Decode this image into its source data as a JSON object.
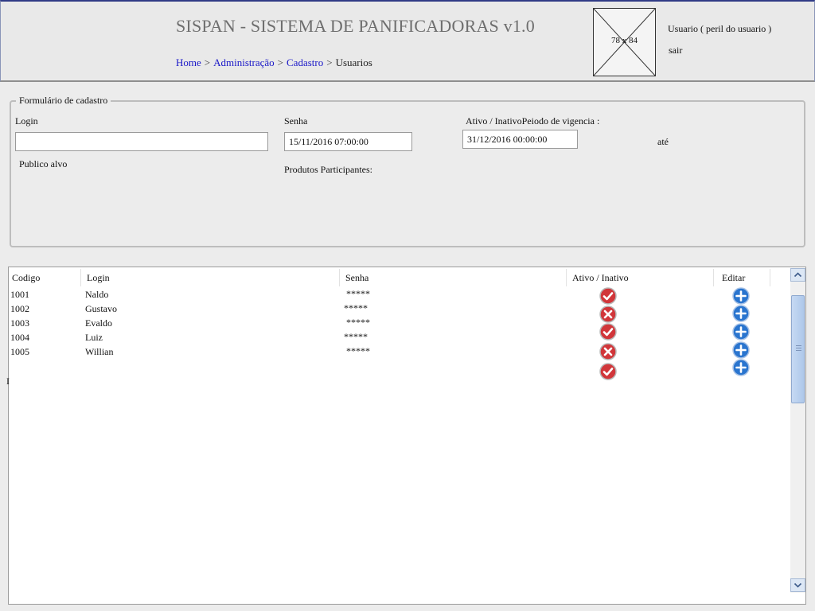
{
  "header": {
    "title": "SISPAN - SISTEMA DE PANIFICADORAS v1.0",
    "breadcrumb": [
      {
        "label": "Home",
        "link": true
      },
      {
        "label": "Administração",
        "link": true
      },
      {
        "label": "Cadastro",
        "link": true
      },
      {
        "label": "Usuarios",
        "link": false
      }
    ],
    "breadcrumb_separator": ">",
    "avatar_label": "78 x 84",
    "user_label": "Usuario ( peril do usuario )",
    "logout_label": "sair"
  },
  "form": {
    "legend": "Formulário de cadastro",
    "login_label": "Login",
    "login_value": "",
    "senha_label": "Senha",
    "senha_value": "15/11/2016 07:00:00",
    "ativo_periodo_label": "Ativo / InativoPeiodo de vigencia :",
    "vigencia_value": "31/12/2016 00:00:00",
    "ate_label": "até",
    "publico_label": "Publico alvo",
    "produtos_label": "Produtos Participantes:"
  },
  "table": {
    "columns": [
      "Codigo",
      "Login",
      "Senha",
      "Ativo / Inativo",
      "Editar"
    ],
    "rows": [
      {
        "codigo": "1001",
        "login": "Naldo",
        "senha": "*****"
      },
      {
        "codigo": "1002",
        "login": "Gustavo",
        "senha": "*****"
      },
      {
        "codigo": "1003",
        "login": "Evaldo",
        "senha": "*****"
      },
      {
        "codigo": "1004",
        "login": "Luiz",
        "senha": "*****"
      },
      {
        "codigo": "1005",
        "login": "Willian",
        "senha": "*****"
      }
    ],
    "status_icons": [
      "check-icon",
      "x-icon",
      "check-icon",
      "x-icon",
      "check-icon"
    ],
    "edit_icons": [
      "plus-icon",
      "plus-icon",
      "plus-icon",
      "plus-icon",
      "plus-icon"
    ],
    "stray_text": "I"
  },
  "colors": {
    "header_bg": "#e9e9e9",
    "link": "#1a18c8",
    "status_red": "#d1363a",
    "edit_blue": "#2a75cf"
  }
}
